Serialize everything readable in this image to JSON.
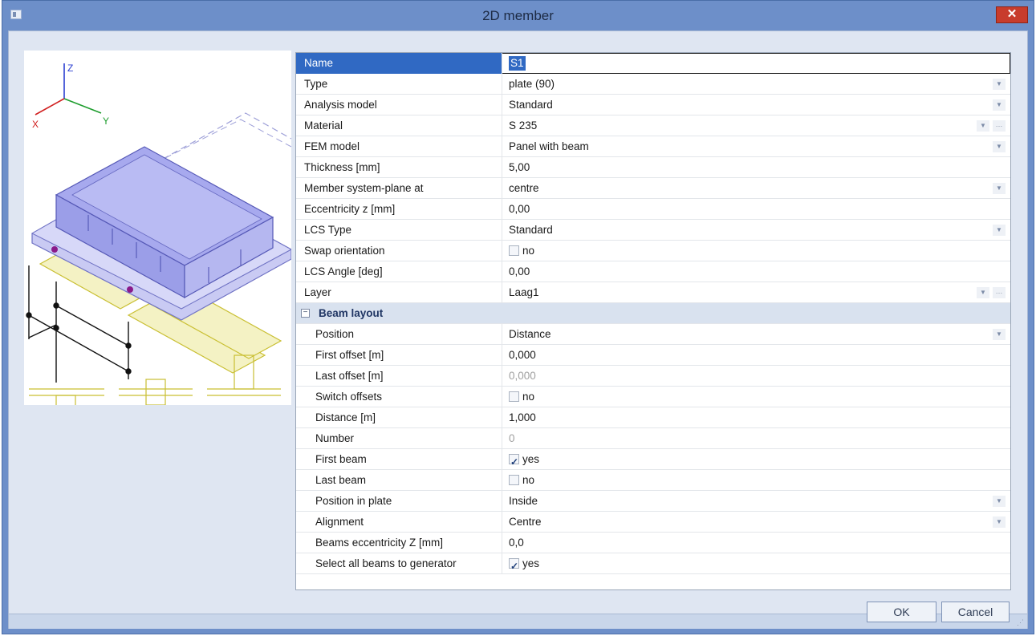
{
  "window": {
    "title": "2D member",
    "close_label": "✕"
  },
  "properties": [
    {
      "name": "Name",
      "value": "S1",
      "kind": "selected"
    },
    {
      "name": "Type",
      "value": "plate (90)",
      "kind": "dropdown"
    },
    {
      "name": "Analysis model",
      "value": "Standard",
      "kind": "dropdown"
    },
    {
      "name": "Material",
      "value": "S 235",
      "kind": "dropdown-more"
    },
    {
      "name": "FEM model",
      "value": "Panel with beam",
      "kind": "dropdown"
    },
    {
      "name": "Thickness [mm]",
      "value": "5,00",
      "kind": "text"
    },
    {
      "name": "Member system-plane at",
      "value": "centre",
      "kind": "dropdown"
    },
    {
      "name": "Eccentricity z [mm]",
      "value": "0,00",
      "kind": "text"
    },
    {
      "name": "LCS Type",
      "value": "Standard",
      "kind": "dropdown"
    },
    {
      "name": "Swap orientation",
      "value": "no",
      "kind": "checkbox",
      "checked": false
    },
    {
      "name": "LCS Angle [deg]",
      "value": "0,00",
      "kind": "text"
    },
    {
      "name": "Layer",
      "value": "Laag1",
      "kind": "dropdown-more"
    }
  ],
  "section": {
    "label": "Beam layout",
    "toggle": "−"
  },
  "beam_layout": [
    {
      "name": "Position",
      "value": "Distance",
      "kind": "dropdown"
    },
    {
      "name": "First offset [m]",
      "value": "0,000",
      "kind": "text"
    },
    {
      "name": "Last offset [m]",
      "value": "0,000",
      "kind": "text-grey"
    },
    {
      "name": "Switch offsets",
      "value": "no",
      "kind": "checkbox",
      "checked": false
    },
    {
      "name": "Distance [m]",
      "value": "1,000",
      "kind": "text"
    },
    {
      "name": "Number",
      "value": "0",
      "kind": "text-grey"
    },
    {
      "name": "First beam",
      "value": "yes",
      "kind": "checkbox",
      "checked": true
    },
    {
      "name": "Last beam",
      "value": "no",
      "kind": "checkbox",
      "checked": false
    },
    {
      "name": "Position in plate",
      "value": "Inside",
      "kind": "dropdown"
    },
    {
      "name": "Alignment",
      "value": "Centre",
      "kind": "dropdown"
    },
    {
      "name": "Beams eccentricity Z  [mm]",
      "value": "0,0",
      "kind": "text"
    },
    {
      "name": "Select all beams to generator",
      "value": "yes",
      "kind": "checkbox",
      "checked": true
    }
  ],
  "preview": {
    "axis_x": "X",
    "axis_y": "Y",
    "axis_z": "Z"
  },
  "buttons": {
    "ok": "OK",
    "cancel": "Cancel"
  },
  "icons": {
    "dropdown": "chevron-down-icon",
    "more": "ellipsis-icon",
    "collapse": "collapse-icon",
    "close": "close-icon",
    "app": "app-icon"
  },
  "colors": {
    "title_bar": "#6d8fc9",
    "selection": "#3069c3",
    "close": "#c83c2c",
    "plate": "#b8b9f0",
    "beam": "#e8e48a"
  }
}
